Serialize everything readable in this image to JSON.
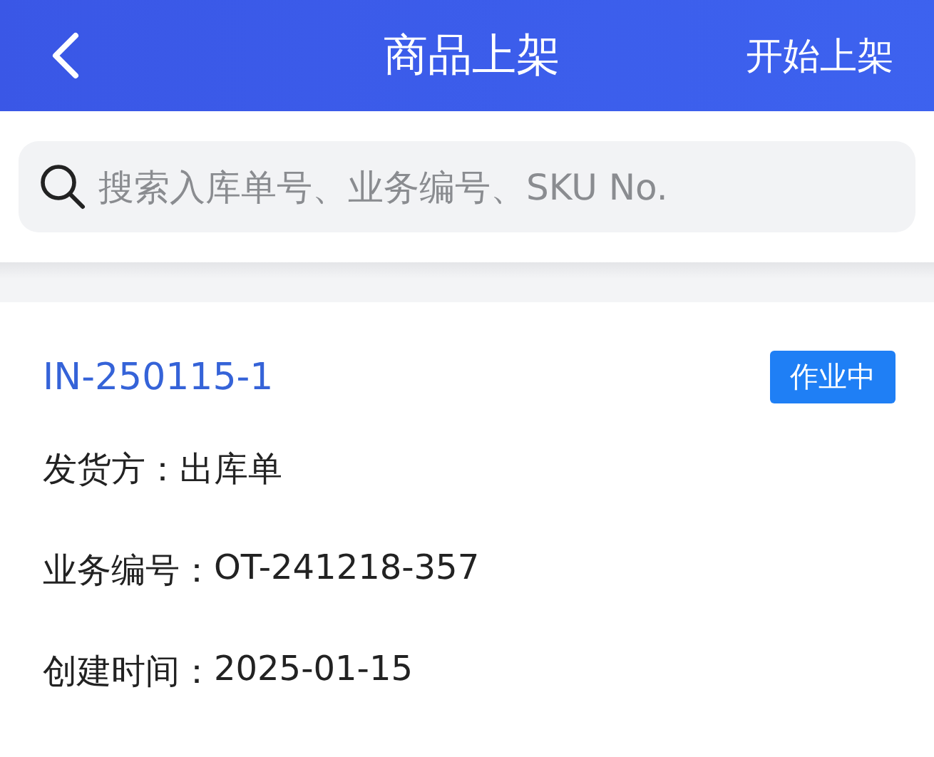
{
  "header": {
    "title": "商品上架",
    "action": "开始上架"
  },
  "search": {
    "placeholder": "搜索入库单号、业务编号、SKU No."
  },
  "order": {
    "number": "IN-250115-1",
    "status": "作业中",
    "fields": [
      {
        "label": "发货方：",
        "value": "出库单"
      },
      {
        "label": "业务编号：",
        "value": "OT-241218-357"
      },
      {
        "label": "创建时间：",
        "value": "2025-01-15"
      }
    ]
  }
}
